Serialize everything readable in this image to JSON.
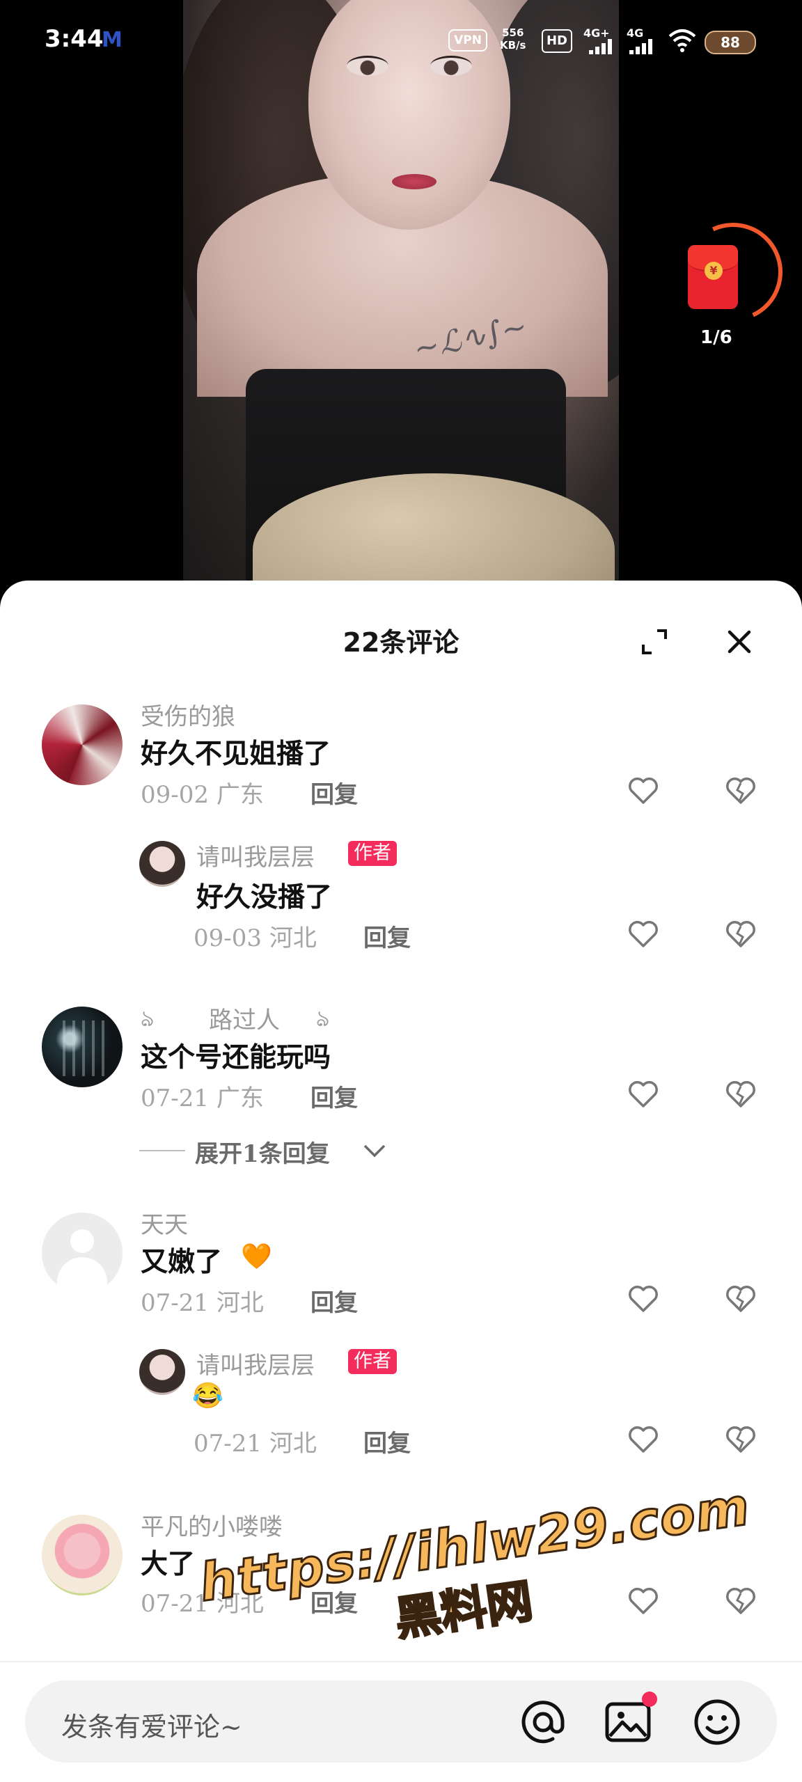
{
  "status_bar": {
    "time": "3:44",
    "app_icon": "M",
    "vpn": "VPN",
    "speed_value": "556",
    "speed_unit": "KB/s",
    "hd": "HD",
    "signal1": "4G+",
    "signal2": "4G",
    "battery": "88"
  },
  "red_envelope": {
    "count": "1/6",
    "coin_symbol": "¥"
  },
  "sheet": {
    "title": "22条评论"
  },
  "comments": [
    {
      "name": "受伤的狼",
      "text": "好久不见姐播了",
      "date_loc": "09-02 广东",
      "reply": "回复"
    },
    {
      "name": "请叫我层层",
      "author_tag": "作者",
      "text": "好久没播了",
      "date_loc": "09-03 河北",
      "reply": "回复"
    },
    {
      "name": "路过人",
      "deco_left": "ঌ",
      "deco_right": "ঌ",
      "text": "这个号还能玩吗",
      "date_loc": "07-21 广东",
      "reply": "回复",
      "expand_label": "展开1条回复"
    },
    {
      "name": "天天",
      "text": "又嫩了",
      "emoji": "🧡",
      "date_loc": "07-21 河北",
      "reply": "回复"
    },
    {
      "name": "请叫我层层",
      "author_tag": "作者",
      "text": "😂",
      "date_loc": "07-21 河北",
      "reply": "回复"
    },
    {
      "name": "平凡的小喽喽",
      "text": "大了",
      "date_loc": "07-21 河北",
      "reply": "回复"
    }
  ],
  "watermark": {
    "url": "https://ihlw29.com",
    "name": "黑料网"
  },
  "input": {
    "placeholder": "发条有爱评论~"
  },
  "colors": {
    "author_tag": "#f42c5c",
    "accent_red": "#e8242f"
  }
}
